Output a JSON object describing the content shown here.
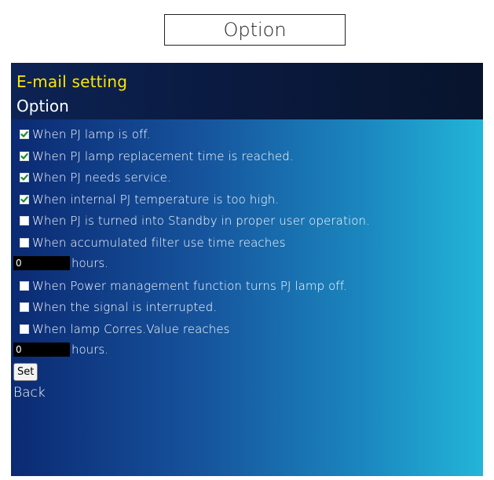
{
  "caption": "Option",
  "header": {
    "title": "E-mail setting",
    "subtitle": "Option"
  },
  "options": [
    {
      "label": "When PJ lamp is off.",
      "checked": true
    },
    {
      "label": "When PJ lamp replacement time is reached.",
      "checked": true
    },
    {
      "label": "When PJ needs service.",
      "checked": true
    },
    {
      "label": "When internal PJ temperature is too high.",
      "checked": true
    },
    {
      "label": "When PJ is turned into Standby in proper user operation.",
      "checked": false
    },
    {
      "label": "When accumulated filter use time reaches",
      "checked": false
    },
    {
      "label": "When Power management function turns PJ lamp off.",
      "checked": false
    },
    {
      "label": "When the signal is interrupted.",
      "checked": false
    },
    {
      "label": "When lamp Corres.Value reaches",
      "checked": false
    }
  ],
  "filter_hours": {
    "value": "0",
    "unit": "hours."
  },
  "lamp_hours": {
    "value": "0",
    "unit": "hours."
  },
  "set_label": "Set",
  "back_label": "Back",
  "colors": {
    "title_yellow": "#ffe600",
    "header_bg": "#0a1a40",
    "content_gradient_start": "#0b2a73",
    "content_gradient_end": "#23b5d8"
  }
}
